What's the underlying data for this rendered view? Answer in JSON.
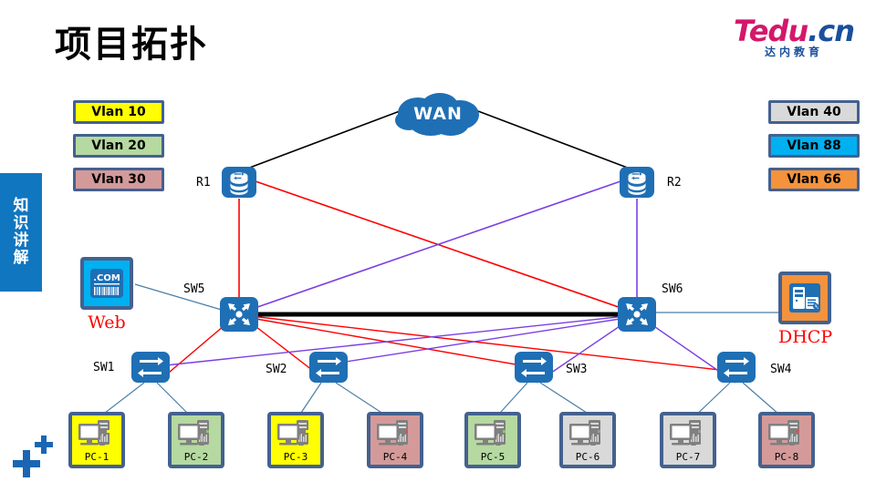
{
  "title": "项目拓扑",
  "side_tab": {
    "chars": [
      "知",
      "识",
      "讲",
      "解"
    ]
  },
  "logo": {
    "part1": "T",
    "part2": "edu",
    "part3": ".cn",
    "sub": "达内教育"
  },
  "vlan_legend_left": [
    {
      "label": "Vlan 10",
      "color": "#ffff00"
    },
    {
      "label": "Vlan 20",
      "color": "#b5d9a0"
    },
    {
      "label": "Vlan 30",
      "color": "#d49a9a"
    }
  ],
  "vlan_legend_right": [
    {
      "label": "Vlan 40",
      "color": "#d9d9d9"
    },
    {
      "label": "Vlan 88",
      "color": "#00b0f0"
    },
    {
      "label": "Vlan 66",
      "color": "#f5933c"
    }
  ],
  "cloud": {
    "label": "WAN"
  },
  "routers": [
    {
      "id": "R1",
      "label": "R1"
    },
    {
      "id": "R2",
      "label": "R2"
    }
  ],
  "core_switches": [
    {
      "id": "SW5",
      "label": "SW5"
    },
    {
      "id": "SW6",
      "label": "SW6"
    }
  ],
  "access_switches": [
    {
      "id": "SW1",
      "label": "SW1"
    },
    {
      "id": "SW2",
      "label": "SW2"
    },
    {
      "id": "SW3",
      "label": "SW3"
    },
    {
      "id": "SW4",
      "label": "SW4"
    }
  ],
  "servers": [
    {
      "id": "WEB",
      "label": "Web",
      "icon": "dotcom-icon",
      "box_color": "#00b0f0"
    },
    {
      "id": "DHCP",
      "label": "DHCP",
      "icon": "server-icon",
      "box_color": "#f5933c"
    }
  ],
  "hosts": [
    {
      "label": "PC-1",
      "color": "#ffff00"
    },
    {
      "label": "PC-2",
      "color": "#b5d9a0"
    },
    {
      "label": "PC-3",
      "color": "#ffff00"
    },
    {
      "label": "PC-4",
      "color": "#d49a9a"
    },
    {
      "label": "PC-5",
      "color": "#b5d9a0"
    },
    {
      "label": "PC-6",
      "color": "#d9d9d9"
    },
    {
      "label": "PC-7",
      "color": "#d9d9d9"
    },
    {
      "label": "PC-8",
      "color": "#d49a9a"
    }
  ],
  "link_colors": {
    "wan": "#000000",
    "trunk": "#000000",
    "red": "#ff0000",
    "purple": "#7b3fe4",
    "thin_blue": "#4a7fa8"
  },
  "colors": {
    "device_blue": "#1f6fb5",
    "frame_blue": "#44618f",
    "tab_blue": "#1176c0",
    "caption_red": "#ff0000"
  }
}
